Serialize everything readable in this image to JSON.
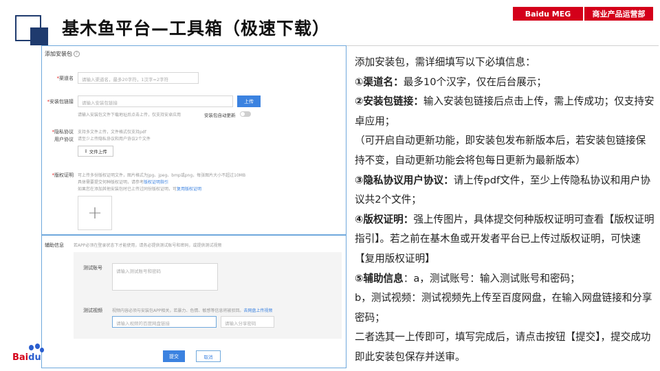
{
  "header": {
    "title": "基木鱼平台—工具箱（极速下载）",
    "brand_left": "Baidu MEG",
    "brand_right": "商业产品运营部"
  },
  "form": {
    "heading": "添加安装包",
    "channel": {
      "label": "渠道名",
      "placeholder": "请输入渠道名，最多20字符，1汉字=2字符"
    },
    "package_link": {
      "label": "安装包链接",
      "placeholder": "请输入安装包链接",
      "upload_button": "上传",
      "hint": "请输入安装包文件下载地址后点击上传，仅支持安卓应用",
      "auto_update_label": "安装包自动更新"
    },
    "privacy": {
      "label_line1": "隐私协议",
      "label_line2": "用户协议",
      "hint_line1": "支持多文件上传，文件格式仅支持pdf",
      "hint_line2": "请至少上传隐私协议和用户协议2个文件",
      "upload_button": "文件上传"
    },
    "copyright": {
      "label": "版权证明",
      "hint_line1": "可上传多份版权证明文件，图片格式为jpg、jpeg、bmp或png，每张图片大小不超过10MB",
      "hint_line2_prefix": "具体需要提交何种版权证明，请参考",
      "hint_line2_link": "版权证明指引",
      "hint_line3_prefix": "如果您在添加其他安装包时已上传过同份版权证明，可",
      "hint_line3_link": "复用版权证明",
      "upload_plus": "+"
    },
    "aux": {
      "label": "辅助信息",
      "hint": "若APP必须在登录状态下才能使用，请务必提供测试账号和密码，或提供测试视频",
      "test_account_label": "测试账号",
      "test_account_placeholder": "请输入测试账号和密码",
      "test_video_label": "测试视频",
      "test_video_hint_prefix": "视频内容必须与安装包APP相关，若暴力、色情、敏感等信息将被驳回。",
      "test_video_hint_link": "去网盘上传视频",
      "netdisk_link_placeholder": "请输入视频的百度网盘链接",
      "share_code_placeholder": "请输入分享密码"
    },
    "submit_button": "提交",
    "cancel_button": "取消"
  },
  "description": {
    "intro": "添加安装包，需详细填写以下必填信息：",
    "item1_title": "①渠道名：",
    "item1_text": "最多10个汉字，仅在后台展示；",
    "item2_title": "②安装包链接：",
    "item2_text": "输入安装包链接后点击上传，需上传成功；仅支持安卓应用；",
    "item2_note": "（可开启自动更新功能，即安装包发布新版本后，若安装包链接保持不变，自动更新功能会将包每日更新为最新版本）",
    "item3_title": "③隐私协议用户协议：",
    "item3_text": "请上传pdf文件，至少上传隐私协议和用户协议共2个文件；",
    "item4_title": "④版权证明：",
    "item4_text": "强上传图片，具体提交何种版权证明可查看【版权证明指引】。若之前在基木鱼或开发者平台已上传过版权证明，可快速【复用版权证明】",
    "item5_title": "⑤辅助信息",
    "item5_text": "：a，测试账号：输入测试账号和密码；",
    "item5_b": "b，测试视频：测试视频先上传至百度网盘，在输入网盘链接和分享密码；",
    "closing": "二者选其一上传即可，填写完成后，请点击按钮【提交】，提交成功即此安装包保存并送审。"
  },
  "logo": {
    "text_red": "Bai",
    "text_blue": "du"
  },
  "colors": {
    "brand_red": "#d4001a",
    "navy": "#1f3b6e",
    "panel_border": "#6fa8dc",
    "button_blue": "#3b82e0"
  }
}
